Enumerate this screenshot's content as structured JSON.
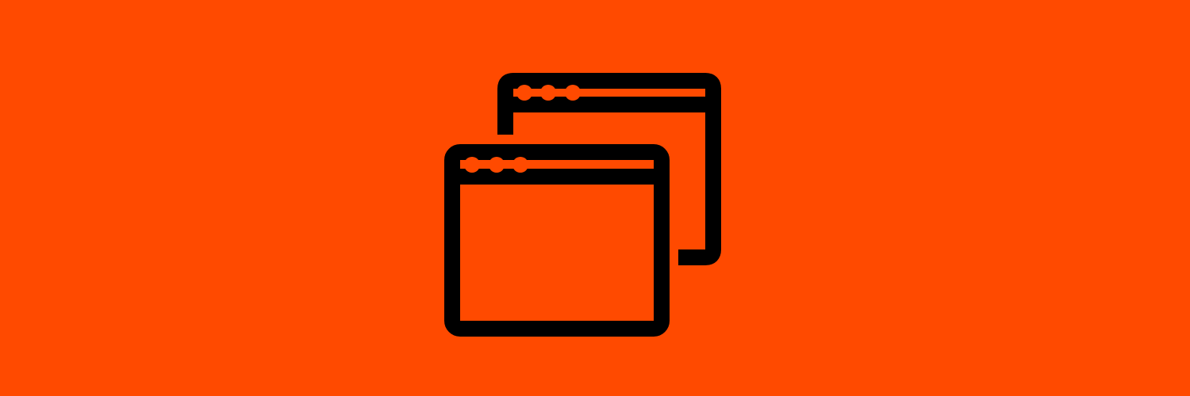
{
  "banner": {
    "background_color": "#FF4A00",
    "icon": {
      "name": "multiple-windows-icon",
      "stroke_color": "#000000",
      "fill_color": "#000000"
    }
  }
}
